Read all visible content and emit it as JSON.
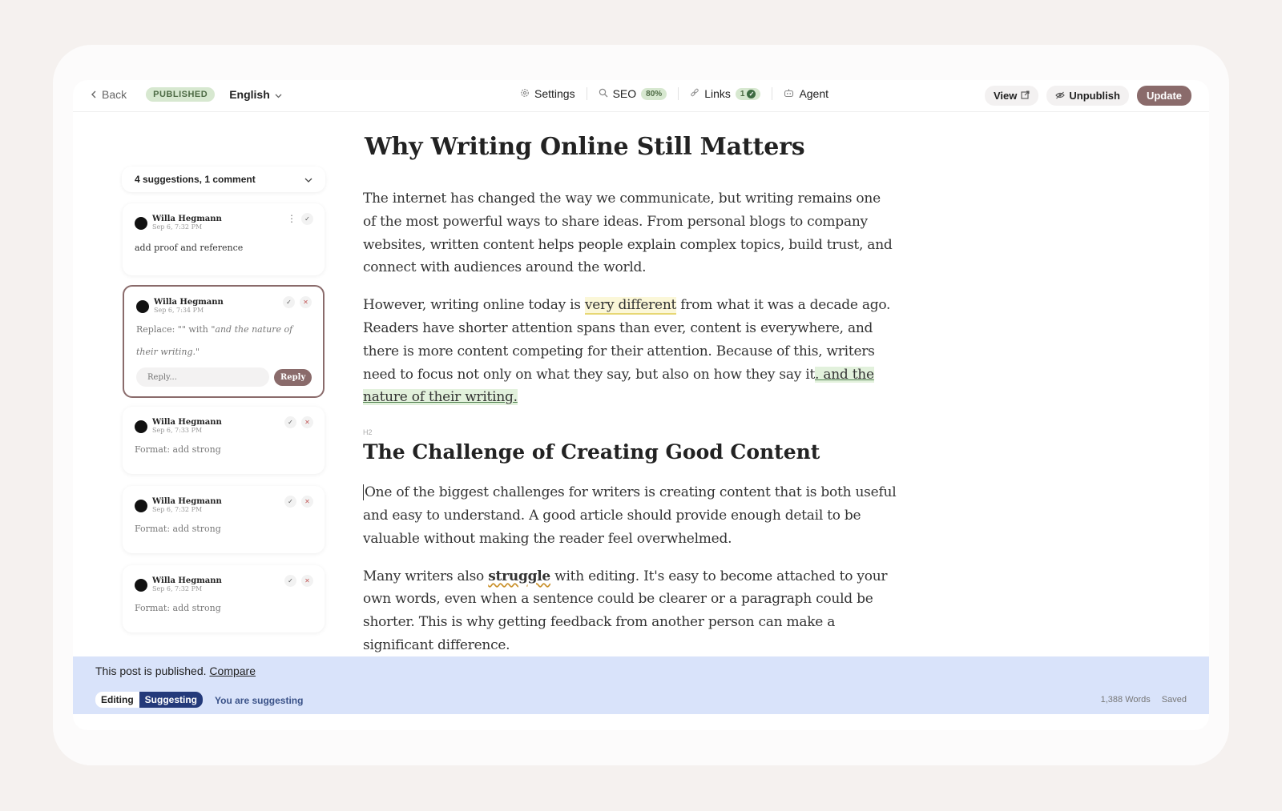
{
  "toolbar": {
    "back_label": "Back",
    "status_badge": "PUBLISHED",
    "language": "English",
    "settings_label": "Settings",
    "seo_label": "SEO",
    "seo_score": "80%",
    "links_label": "Links",
    "links_count": "1",
    "agent_label": "Agent",
    "view_label": "View",
    "unpublish_label": "Unpublish",
    "update_label": "Update"
  },
  "sidebar": {
    "summary": "4 suggestions, 1 comment",
    "cards": [
      {
        "author": "Willa Hegmann",
        "date": "Sep 6, 7:32 PM",
        "text": "add proof and reference"
      },
      {
        "author": "Willa Hegmann",
        "date": "Sep 6, 7:34 PM",
        "prefix": "Replace: \"\" with ",
        "quote": "\"and the nature of their writing.\"",
        "reply_placeholder": "Reply...",
        "reply_label": "Reply"
      },
      {
        "author": "Willa Hegmann",
        "date": "Sep 6, 7:33 PM",
        "text": "Format: add strong"
      },
      {
        "author": "Willa Hegmann",
        "date": "Sep 6, 7:32 PM",
        "text": "Format: add strong"
      },
      {
        "author": "Willa Hegmann",
        "date": "Sep 6, 7:32 PM",
        "text": "Format: add strong"
      }
    ]
  },
  "article": {
    "title": "Why Writing Online Still Matters",
    "p1": "The internet has changed the way we communicate, but writing remains one of the most powerful ways to share ideas. From personal blogs to company websites, written content helps people explain complex topics, build trust, and connect with audiences around the world.",
    "p2_a": "However, writing online today is ",
    "p2_hl": "very different",
    "p2_b": " from what it was a decade ago. Readers have shorter attention spans than ever, content is everywhere, and there is more content competing for their attention. Because of this, writers need to focus not only on what they say, but also on how they say it",
    "p2_ins": ". and the nature of their writing.",
    "h2_tag": "H2",
    "h2": "The Challenge of Creating Good Content",
    "p3": "One of the biggest challenges for writers is creating content that is both useful and easy to understand. A good article should provide enough detail to be valuable without making the reader feel overwhelmed.",
    "p4_a": "Many writers also ",
    "p4_word": "struggle",
    "p4_b": " with editing. It's easy to become attached to your own words, even when a sentence could be clearer or a paragraph could be shorter. This is why getting feedback from another person can make a significant difference."
  },
  "footer": {
    "published_note": "This post is published.",
    "compare_link": "Compare",
    "mode_editing": "Editing",
    "mode_suggesting": "Suggesting",
    "suggesting_note": "You are suggesting",
    "word_count": "1,388 Words",
    "save_status": "Saved"
  },
  "colors": {
    "accent": "#8a6b6b",
    "footer_bg": "#d9e3fa",
    "badge_green": "#d7e8d0",
    "mode_active": "#243a7a"
  }
}
